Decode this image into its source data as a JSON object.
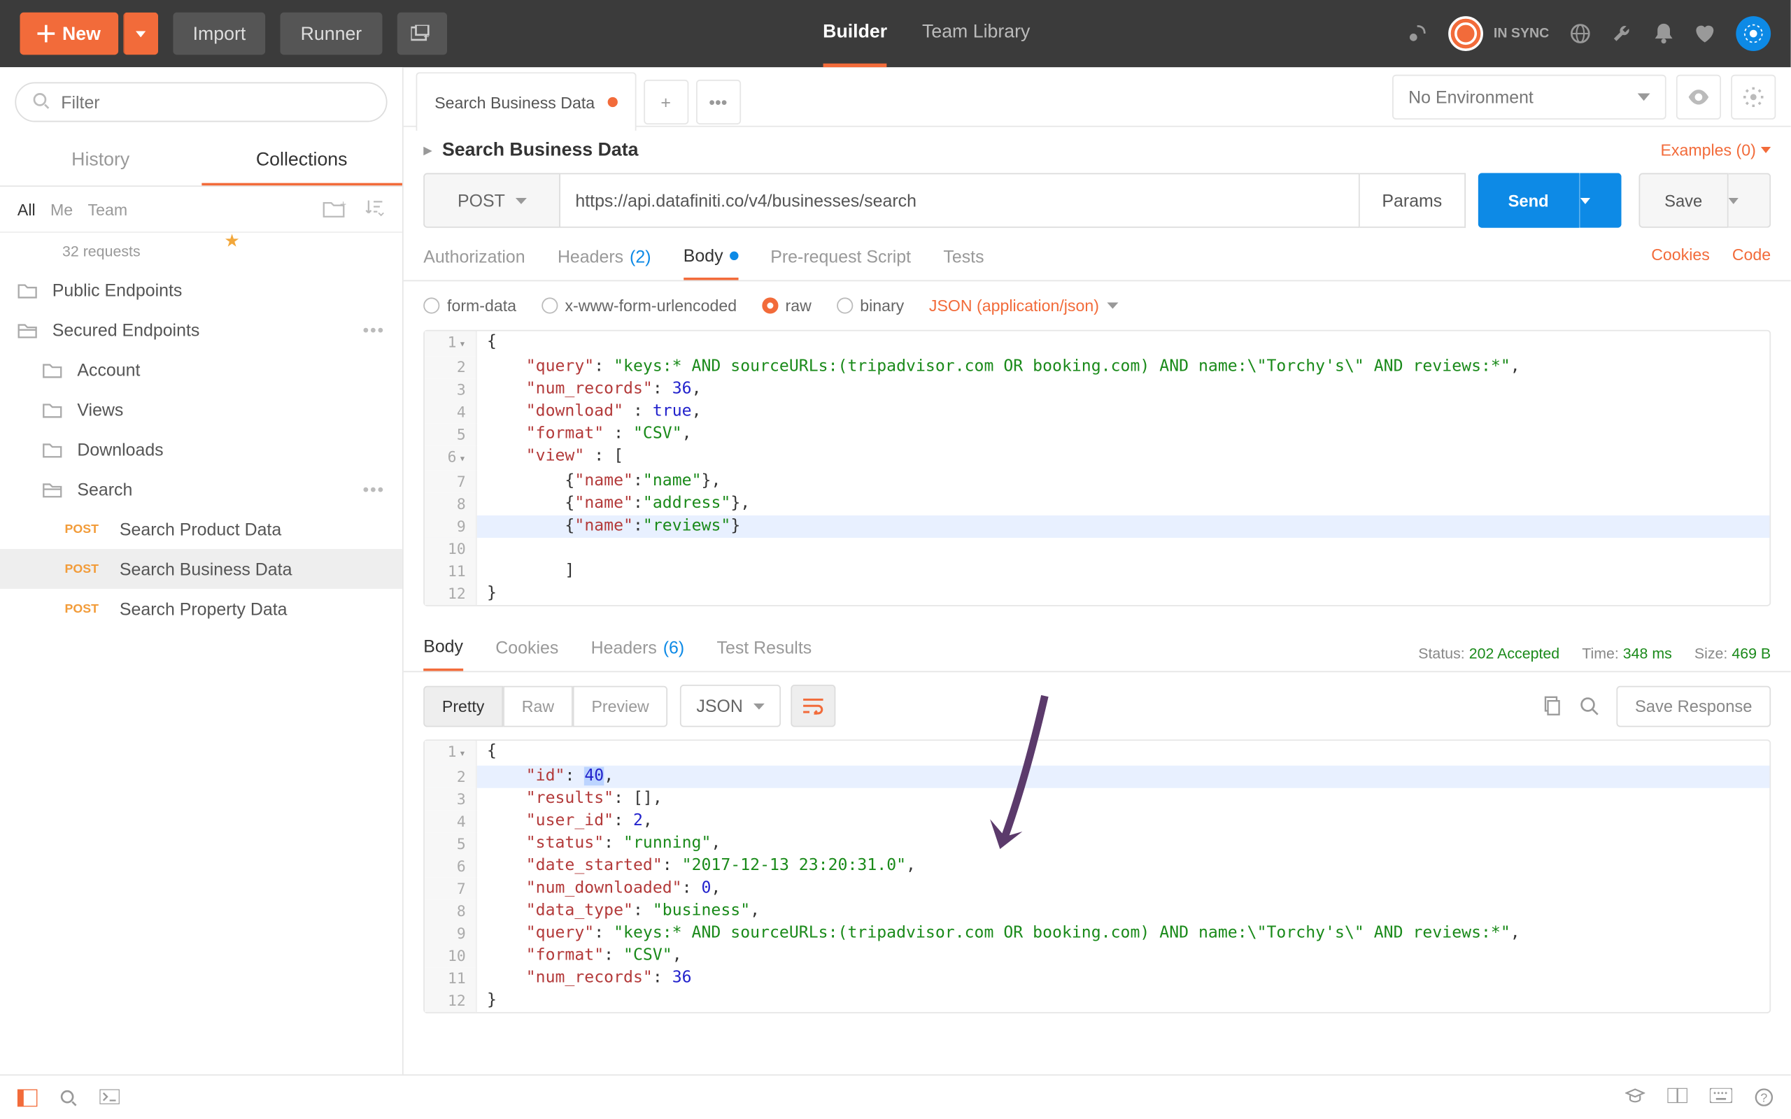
{
  "topbar": {
    "new_label": "New",
    "import_label": "Import",
    "runner_label": "Runner",
    "tab_builder": "Builder",
    "tab_team": "Team Library",
    "sync_label": "IN SYNC"
  },
  "sidebar": {
    "filter_placeholder": "Filter",
    "tab_history": "History",
    "tab_collections": "Collections",
    "scope_all": "All",
    "scope_me": "Me",
    "scope_team": "Team",
    "collection_sub": "32 requests",
    "folders": {
      "public": "Public Endpoints",
      "secured": "Secured Endpoints",
      "account": "Account",
      "views": "Views",
      "downloads": "Downloads",
      "search": "Search"
    },
    "reqs": {
      "product": "Search Product Data",
      "business": "Search Business Data",
      "property": "Search Property Data",
      "method": "POST"
    }
  },
  "tabs": {
    "open_tab": "Search Business Data",
    "env_label": "No Environment"
  },
  "request": {
    "title": "Search Business Data",
    "examples": "Examples (0)",
    "method": "POST",
    "url": "https://api.datafiniti.co/v4/businesses/search",
    "params_label": "Params",
    "send_label": "Send",
    "save_label": "Save",
    "tabs": {
      "auth": "Authorization",
      "headers": "Headers",
      "headers_cnt": "(2)",
      "body": "Body",
      "prereq": "Pre-request Script",
      "tests": "Tests",
      "cookies": "Cookies",
      "code": "Code"
    },
    "body_opts": {
      "formdata": "form-data",
      "urlenc": "x-www-form-urlencoded",
      "raw": "raw",
      "binary": "binary",
      "json_type": "JSON (application/json)"
    },
    "body": {
      "l1": "{",
      "l2a": "    \"query\"",
      "l2b": ": ",
      "l2c": "\"keys:* AND sourceURLs:(tripadvisor.com OR booking.com) AND name:\\\"Torchy's\\\" AND reviews:*\"",
      "l2d": ",",
      "l3a": "    \"num_records\"",
      "l3b": ": ",
      "l3c": "36",
      "l3d": ",",
      "l4a": "    \"download\" ",
      "l4b": ": ",
      "l4c": "true",
      "l4d": ",",
      "l5a": "    \"format\" ",
      "l5b": ": ",
      "l5c": "\"CSV\"",
      "l5d": ",",
      "l6a": "    \"view\" ",
      "l6b": ": [",
      "l7a": "        {",
      "l7b": "\"name\"",
      "l7c": ":",
      "l7d": "\"name\"",
      "l7e": "},",
      "l8a": "        {",
      "l8b": "\"name\"",
      "l8c": ":",
      "l8d": "\"address\"",
      "l8e": "},",
      "l9a": "        {",
      "l9b": "\"name\"",
      "l9c": ":",
      "l9d": "\"reviews\"",
      "l9e": "}",
      "l10": "",
      "l11": "        ]",
      "l12": "}"
    }
  },
  "response": {
    "tabs": {
      "body": "Body",
      "cookies": "Cookies",
      "headers": "Headers",
      "headers_cnt": "(6)",
      "tests": "Test Results"
    },
    "status_lbl": "Status:",
    "status_val": "202 Accepted",
    "time_lbl": "Time:",
    "time_val": "348 ms",
    "size_lbl": "Size:",
    "size_val": "469 B",
    "view": {
      "pretty": "Pretty",
      "raw": "Raw",
      "preview": "Preview",
      "lang": "JSON",
      "save": "Save Response"
    },
    "body": {
      "l1": "{",
      "l2a": "    \"id\"",
      "l2b": ": ",
      "l2c": "40",
      "l2d": ",",
      "l3a": "    \"results\"",
      "l3b": ": [],",
      "l4a": "    \"user_id\"",
      "l4b": ": ",
      "l4c": "2",
      "l4d": ",",
      "l5a": "    \"status\"",
      "l5b": ": ",
      "l5c": "\"running\"",
      "l5d": ",",
      "l6a": "    \"date_started\"",
      "l6b": ": ",
      "l6c": "\"2017-12-13 23:20:31.0\"",
      "l6d": ",",
      "l7a": "    \"num_downloaded\"",
      "l7b": ": ",
      "l7c": "0",
      "l7d": ",",
      "l8a": "    \"data_type\"",
      "l8b": ": ",
      "l8c": "\"business\"",
      "l8d": ",",
      "l9a": "    \"query\"",
      "l9b": ": ",
      "l9c": "\"keys:* AND sourceURLs:(tripadvisor.com OR booking.com) AND name:\\\"Torchy's\\\" AND reviews:*\"",
      "l9d": ",",
      "l10a": "    \"format\"",
      "l10b": ": ",
      "l10c": "\"CSV\"",
      "l10d": ",",
      "l11a": "    \"num_records\"",
      "l11b": ": ",
      "l11c": "36",
      "l12": "}"
    }
  }
}
